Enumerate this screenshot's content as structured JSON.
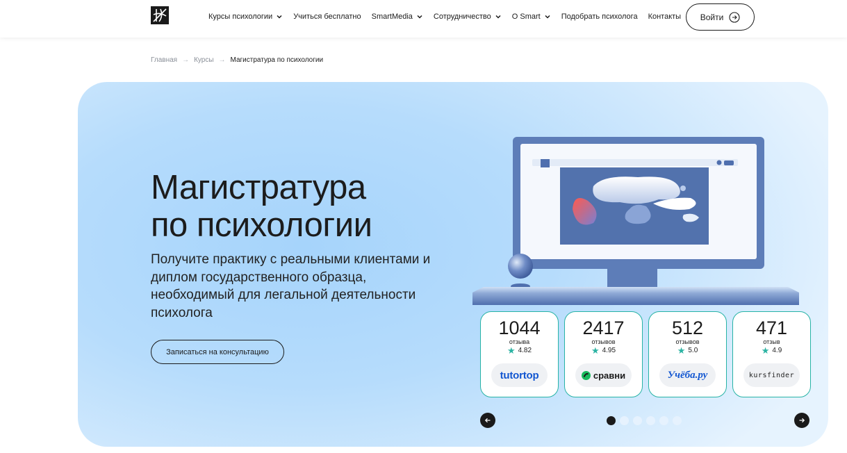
{
  "header": {
    "nav": [
      {
        "label": "Курсы психологии",
        "dropdown": true
      },
      {
        "label": "Учиться бесплатно",
        "dropdown": false
      },
      {
        "label": "SmartMedia",
        "dropdown": true
      },
      {
        "label": "Сотрудничество",
        "dropdown": true
      },
      {
        "label": "О Smart",
        "dropdown": true
      },
      {
        "label": "Подобрать психолога",
        "dropdown": false
      },
      {
        "label": "Контакты",
        "dropdown": false
      }
    ],
    "login_label": "Войти"
  },
  "breadcrumb": {
    "items": [
      "Главная",
      "Курсы",
      "Магистратура по психологии"
    ],
    "separator": "→"
  },
  "hero": {
    "title_line1": "Магистратура",
    "title_line2": "по психологии",
    "subtitle": "Получите практику с реальными клиентами и диплом государственного образца, необходимый для легальной деятельности психолога",
    "cta_label": "Записаться на консультацию"
  },
  "ratings": [
    {
      "count": "1044",
      "label": "отзыва",
      "score": "4.82",
      "platform": "tutortop"
    },
    {
      "count": "2417",
      "label": "отзывов",
      "score": "4.95",
      "platform": "сравни"
    },
    {
      "count": "512",
      "label": "отзывов",
      "score": "5.0",
      "platform": "Учёба.ру"
    },
    {
      "count": "471",
      "label": "отзыв",
      "score": "4.9",
      "platform": "kursfinder"
    }
  ],
  "slider": {
    "total_dots": 6,
    "active_dot": 1
  },
  "colors": {
    "accent_teal": "#27b3a6",
    "hero_blue": "#b6dcfc",
    "text_dark": "#1a1a1a",
    "brand_blue": "#1357d1"
  },
  "icons": [
    "logo-icon",
    "chevron-down-icon",
    "arrow-right-circle-icon",
    "star-icon",
    "arrow-left-icon",
    "arrow-right-icon"
  ]
}
